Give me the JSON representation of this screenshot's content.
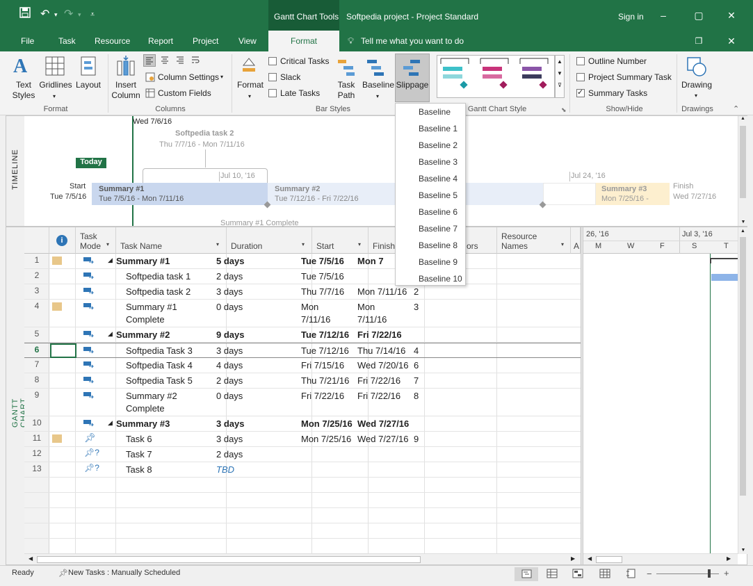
{
  "app": {
    "context_tab_title": "Gantt Chart Tools",
    "window_title": "Softpedia project - Project Standard",
    "sign_in": "Sign in"
  },
  "tabs": [
    "File",
    "Task",
    "Resource",
    "Report",
    "Project",
    "View",
    "Format"
  ],
  "tell_me": "Tell me what you want to do",
  "ribbon": {
    "text_styles": "Text Styles",
    "gridlines": "Gridlines",
    "layout": "Layout",
    "group_format": "Format",
    "insert_column": "Insert Column",
    "column_settings": "Column Settings",
    "custom_fields": "Custom Fields",
    "group_columns": "Columns",
    "format_btn": "Format",
    "critical_tasks": "Critical Tasks",
    "slack": "Slack",
    "late_tasks": "Late Tasks",
    "task_path": "Task Path",
    "baseline": "Baseline",
    "slippage": "Slippage",
    "group_bar_styles": "Bar Styles",
    "group_gantt_style": "Gantt Chart Style",
    "outline_number": "Outline Number",
    "project_summary_task": "Project Summary Task",
    "summary_tasks": "Summary Tasks",
    "group_show_hide": "Show/Hide",
    "drawing": "Drawing",
    "group_drawings": "Drawings"
  },
  "slippage_menu": [
    "Baseline",
    "Baseline 1",
    "Baseline 2",
    "Baseline 3",
    "Baseline 4",
    "Baseline 5",
    "Baseline 6",
    "Baseline 7",
    "Baseline 8",
    "Baseline 9",
    "Baseline 10"
  ],
  "timeline": {
    "label": "TIMELINE",
    "current_date": "Wed 7/6/16",
    "callout_title": "Softpedia task 2",
    "callout_dates": "Thu 7/7/16 - Mon 7/11/16",
    "today": "Today",
    "start_label": "Start",
    "start_date": "Tue 7/5/16",
    "tick_1": "Jul 10, '16",
    "tick_2": "Jul 24, '16",
    "bar1_title": "Summary #1",
    "bar1_dates": "Tue 7/5/16 - Mon 7/11/16",
    "bar2_title": "Summary #2",
    "bar2_dates": "Tue 7/12/16 - Fri 7/22/16",
    "bar3_title": "Summary #3",
    "bar3_dates": "Mon 7/25/16 -",
    "finish_label": "Finish",
    "finish_date": "Wed 7/27/16",
    "milestone_label": "Summary #1 Complete"
  },
  "grid": {
    "label": "GANTT CHART",
    "headers": {
      "task_mode": "Task Mode",
      "task_name": "Task Name",
      "duration": "Duration",
      "start": "Start",
      "finish": "Finish",
      "predecessors": "ors",
      "resource_names": "Resource Names",
      "add": "A"
    },
    "chart_headers": {
      "week1": "26, '16",
      "week2": "Jul 3, '16",
      "days": [
        "M",
        "W",
        "F",
        "S",
        "T"
      ]
    },
    "rows": [
      {
        "id": "1",
        "name": "Summary #1",
        "duration": "5 days",
        "start": "Tue 7/5/16",
        "finish": "Mon 7",
        "pred": "",
        "bold": true,
        "summary": true,
        "note": true
      },
      {
        "id": "2",
        "name": "Softpedia task 1",
        "duration": "2 days",
        "start": "Tue 7/5/16",
        "finish": "",
        "pred": "",
        "bold": false,
        "summary": false,
        "note": false
      },
      {
        "id": "3",
        "name": "Softpedia task 2",
        "duration": "3 days",
        "start": "Thu 7/7/16",
        "finish": "Mon 7/11/16",
        "pred": "2",
        "bold": false,
        "summary": false,
        "note": false
      },
      {
        "id": "4",
        "name": "Summary #1",
        "name2": "Complete",
        "duration": "0 days",
        "start": "Mon",
        "start2": "7/11/16",
        "finish": "Mon",
        "finish2": "7/11/16",
        "pred": "3",
        "bold": false,
        "summary": false,
        "note": true
      },
      {
        "id": "5",
        "name": "Summary #2",
        "duration": "9 days",
        "start": "Tue 7/12/16",
        "finish": "Fri 7/22/16",
        "pred": "",
        "bold": true,
        "summary": true,
        "note": false
      },
      {
        "id": "6",
        "name": "Softpedia Task 3",
        "duration": "3 days",
        "start": "Tue 7/12/16",
        "finish": "Thu 7/14/16",
        "pred": "4",
        "bold": false,
        "summary": false,
        "note": false
      },
      {
        "id": "7",
        "name": "Softpedia Task 4",
        "duration": "4 days",
        "start": "Fri 7/15/16",
        "finish": "Wed 7/20/16",
        "pred": "6",
        "bold": false,
        "summary": false,
        "note": false
      },
      {
        "id": "8",
        "name": "Softpedia Task 5",
        "duration": "2 days",
        "start": "Thu 7/21/16",
        "finish": "Fri 7/22/16",
        "pred": "7",
        "bold": false,
        "summary": false,
        "note": false
      },
      {
        "id": "9",
        "name": "Summary #2",
        "name2": "Complete",
        "duration": "0 days",
        "start": "Fri 7/22/16",
        "finish": "Fri 7/22/16",
        "pred": "8",
        "bold": false,
        "summary": false,
        "note": false
      },
      {
        "id": "10",
        "name": "Summary #3",
        "duration": "3 days",
        "start": "Mon 7/25/16",
        "finish": "Wed 7/27/16",
        "pred": "",
        "bold": true,
        "summary": true,
        "note": false
      },
      {
        "id": "11",
        "name": "Task 6",
        "duration": "3 days",
        "start": "Mon 7/25/16",
        "finish": "Wed 7/27/16",
        "pred": "9",
        "bold": false,
        "summary": false,
        "note": true
      },
      {
        "id": "12",
        "name": "Task 7",
        "duration": "2 days",
        "start": "",
        "finish": "",
        "pred": "",
        "bold": false,
        "summary": false,
        "note": false
      },
      {
        "id": "13",
        "name": "Task 8",
        "duration": "TBD",
        "start": "",
        "finish": "",
        "pred": "",
        "bold": false,
        "summary": false,
        "note": false
      }
    ]
  },
  "status": {
    "ready": "Ready",
    "new_tasks": "New Tasks : Manually Scheduled"
  },
  "colors": {
    "brand": "#217346",
    "today": "#217346",
    "bar_blue": "#dae3f3",
    "bar_orange": "#fdefcf"
  }
}
